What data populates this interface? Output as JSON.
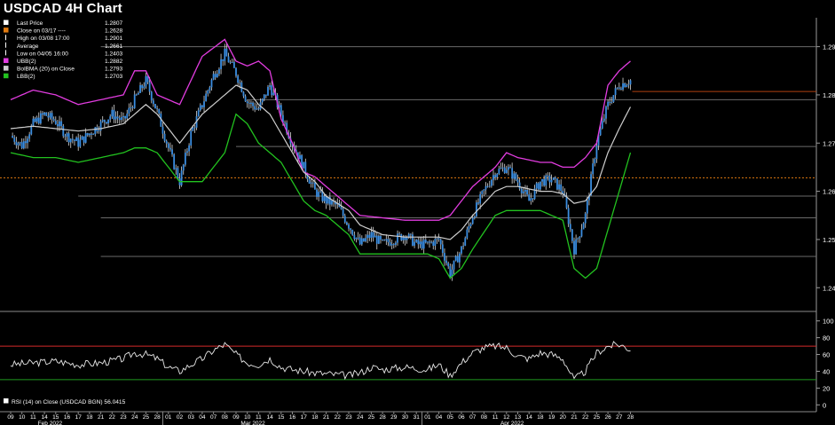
{
  "title": "USDCAD 4H Chart",
  "colors": {
    "background": "#000000",
    "candle": "#3a8de0",
    "upper_band": "#e23ce0",
    "lower_band": "#22c21f",
    "ma": "#cfcfcf",
    "close_line": "#e07a10",
    "last_price_line": "#b04010",
    "rsi_line": "#e8e8e8",
    "rsi_overbought": "#d42a2a",
    "rsi_oversold": "#1f9a1f",
    "grid": "#6a6a6a",
    "text": "#ffffff"
  },
  "legend": [
    {
      "label": "Last Price",
      "value": "1.2807",
      "swatch": "#ffffff",
      "style": "box"
    },
    {
      "label": "Close on 03/17 ----",
      "value": "1.2628",
      "swatch": "#e07a10",
      "style": "box"
    },
    {
      "label": "High on 03/08 17:00",
      "value": "1.2901",
      "swatch": "#ffffff",
      "style": "mark"
    },
    {
      "label": "Average",
      "value": "1.2661",
      "swatch": "#ffffff",
      "style": "mark"
    },
    {
      "label": "Low on 04/05 16:00",
      "value": "1.2403",
      "swatch": "#ffffff",
      "style": "mark"
    },
    {
      "label": "UBB(2)",
      "value": "1.2882",
      "swatch": "#e23ce0",
      "style": "box"
    },
    {
      "label": "BolBMA (20)  on Close",
      "value": "1.2793",
      "swatch": "#cfcfcf",
      "style": "box"
    },
    {
      "label": "LBB(2)",
      "value": "1.2703",
      "swatch": "#22c21f",
      "style": "box"
    }
  ],
  "rsi_legend": "RSI (14)  on Close (USDCAD BGN) 56.0415",
  "chart_data": {
    "type": "line",
    "price_axis": {
      "ticks": [
        "1.24",
        "1.25",
        "1.26",
        "1.27",
        "1.28",
        "1.29"
      ],
      "ylim": [
        1.236,
        1.296
      ]
    },
    "rsi_axis": {
      "ticks": [
        "0",
        "20",
        "40",
        "60",
        "80",
        "100"
      ],
      "ylim": [
        -6,
        106
      ]
    },
    "x_tick_labels": [
      "09",
      "10",
      "11",
      "14",
      "15",
      "16",
      "17",
      "18",
      "21",
      "22",
      "23",
      "24",
      "25",
      "28",
      "01",
      "02",
      "03",
      "04",
      "07",
      "08",
      "09",
      "10",
      "11",
      "14",
      "15",
      "16",
      "17",
      "18",
      "21",
      "22",
      "23",
      "24",
      "25",
      "28",
      "29",
      "30",
      "31",
      "01",
      "04",
      "05",
      "06",
      "07",
      "08",
      "11",
      "12",
      "13",
      "14",
      "18",
      "19",
      "20",
      "21",
      "22",
      "25",
      "26",
      "27",
      "28"
    ],
    "month_labels": [
      {
        "label": "Feb 2022",
        "at_tick": 3
      },
      {
        "label": "Mar 2022",
        "at_tick": 21
      },
      {
        "label": "Apr 2022",
        "at_tick": 44
      }
    ],
    "horizontal_levels": [
      {
        "value": 1.29,
        "x_start_tick": 8
      },
      {
        "value": 1.279,
        "x_start_tick": 21
      },
      {
        "value": 1.2693,
        "x_start_tick": 20
      },
      {
        "value": 1.259,
        "x_start_tick": 6
      },
      {
        "value": 1.2545,
        "x_start_tick": 8
      },
      {
        "value": 1.2465,
        "x_start_tick": 8
      }
    ],
    "close_on_0317": 1.2628,
    "last_price": 1.2807,
    "rsi_levels": {
      "overbought": 70,
      "oversold": 30
    },
    "rsi_last": 56.0415,
    "price_keypoints": [
      [
        0,
        1.2715
      ],
      [
        1,
        1.2695
      ],
      [
        2,
        1.274
      ],
      [
        3,
        1.276
      ],
      [
        4,
        1.2745
      ],
      [
        5,
        1.2715
      ],
      [
        6,
        1.27
      ],
      [
        7,
        1.272
      ],
      [
        8,
        1.274
      ],
      [
        9,
        1.276
      ],
      [
        10,
        1.2745
      ],
      [
        11,
        1.279
      ],
      [
        12,
        1.283
      ],
      [
        13,
        1.2765
      ],
      [
        14,
        1.269
      ],
      [
        15,
        1.262
      ],
      [
        16,
        1.272
      ],
      [
        17,
        1.278
      ],
      [
        18,
        1.284
      ],
      [
        19,
        1.2885
      ],
      [
        20,
        1.2845
      ],
      [
        21,
        1.2785
      ],
      [
        22,
        1.277
      ],
      [
        23,
        1.282
      ],
      [
        24,
        1.276
      ],
      [
        25,
        1.27
      ],
      [
        26,
        1.265
      ],
      [
        27,
        1.26
      ],
      [
        28,
        1.258
      ],
      [
        29,
        1.257
      ],
      [
        30,
        1.253
      ],
      [
        31,
        1.249
      ],
      [
        32,
        1.251
      ],
      [
        33,
        1.249
      ],
      [
        34,
        1.25
      ],
      [
        35,
        1.251
      ],
      [
        36,
        1.249
      ],
      [
        37,
        1.249
      ],
      [
        38,
        1.25
      ],
      [
        39,
        1.243
      ],
      [
        40,
        1.248
      ],
      [
        41,
        1.255
      ],
      [
        42,
        1.26
      ],
      [
        43,
        1.264
      ],
      [
        44,
        1.265
      ],
      [
        45,
        1.262
      ],
      [
        46,
        1.258
      ],
      [
        47,
        1.262
      ],
      [
        48,
        1.2625
      ],
      [
        49,
        1.26
      ],
      [
        50,
        1.248
      ],
      [
        51,
        1.255
      ],
      [
        52,
        1.27
      ],
      [
        53,
        1.278
      ],
      [
        54,
        1.282
      ],
      [
        55,
        1.283
      ],
      [
        56,
        1.2807
      ]
    ],
    "upper_band_keypoints": [
      [
        0,
        1.279
      ],
      [
        2,
        1.281
      ],
      [
        4,
        1.28
      ],
      [
        6,
        1.278
      ],
      [
        8,
        1.279
      ],
      [
        10,
        1.28
      ],
      [
        11,
        1.285
      ],
      [
        12,
        1.285
      ],
      [
        13,
        1.28
      ],
      [
        15,
        1.278
      ],
      [
        17,
        1.288
      ],
      [
        19,
        1.2915
      ],
      [
        20,
        1.287
      ],
      [
        21,
        1.286
      ],
      [
        22,
        1.287
      ],
      [
        23,
        1.285
      ],
      [
        24,
        1.275
      ],
      [
        25,
        1.27
      ],
      [
        26,
        1.264
      ],
      [
        27,
        1.263
      ],
      [
        28,
        1.261
      ],
      [
        30,
        1.257
      ],
      [
        31,
        1.255
      ],
      [
        33,
        1.2545
      ],
      [
        35,
        1.254
      ],
      [
        37,
        1.254
      ],
      [
        38,
        1.254
      ],
      [
        39,
        1.255
      ],
      [
        40,
        1.258
      ],
      [
        41,
        1.261
      ],
      [
        43,
        1.265
      ],
      [
        44,
        1.268
      ],
      [
        45,
        1.267
      ],
      [
        47,
        1.266
      ],
      [
        48,
        1.266
      ],
      [
        49,
        1.265
      ],
      [
        50,
        1.265
      ],
      [
        51,
        1.267
      ],
      [
        52,
        1.27
      ],
      [
        53,
        1.282
      ],
      [
        54,
        1.285
      ],
      [
        55,
        1.287
      ],
      [
        56,
        1.2885
      ]
    ],
    "ma_keypoints": [
      [
        0,
        1.273
      ],
      [
        2,
        1.2735
      ],
      [
        4,
        1.273
      ],
      [
        6,
        1.2725
      ],
      [
        8,
        1.273
      ],
      [
        10,
        1.274
      ],
      [
        11,
        1.276
      ],
      [
        12,
        1.278
      ],
      [
        13,
        1.276
      ],
      [
        15,
        1.27
      ],
      [
        17,
        1.276
      ],
      [
        19,
        1.28
      ],
      [
        20,
        1.282
      ],
      [
        21,
        1.281
      ],
      [
        22,
        1.278
      ],
      [
        23,
        1.276
      ],
      [
        24,
        1.272
      ],
      [
        25,
        1.268
      ],
      [
        26,
        1.264
      ],
      [
        27,
        1.262
      ],
      [
        28,
        1.259
      ],
      [
        30,
        1.256
      ],
      [
        31,
        1.253
      ],
      [
        33,
        1.251
      ],
      [
        35,
        1.2505
      ],
      [
        37,
        1.2505
      ],
      [
        38,
        1.2505
      ],
      [
        39,
        1.25
      ],
      [
        40,
        1.252
      ],
      [
        41,
        1.255
      ],
      [
        43,
        1.26
      ],
      [
        44,
        1.261
      ],
      [
        45,
        1.261
      ],
      [
        47,
        1.26
      ],
      [
        48,
        1.26
      ],
      [
        49,
        1.2595
      ],
      [
        50,
        1.2575
      ],
      [
        51,
        1.258
      ],
      [
        52,
        1.261
      ],
      [
        53,
        1.268
      ],
      [
        54,
        1.273
      ],
      [
        55,
        1.2775
      ],
      [
        56,
        1.2793
      ]
    ],
    "lower_band_keypoints": [
      [
        0,
        1.268
      ],
      [
        2,
        1.267
      ],
      [
        4,
        1.267
      ],
      [
        6,
        1.266
      ],
      [
        8,
        1.267
      ],
      [
        10,
        1.268
      ],
      [
        11,
        1.269
      ],
      [
        12,
        1.269
      ],
      [
        13,
        1.268
      ],
      [
        15,
        1.262
      ],
      [
        17,
        1.262
      ],
      [
        19,
        1.268
      ],
      [
        20,
        1.276
      ],
      [
        21,
        1.274
      ],
      [
        22,
        1.27
      ],
      [
        23,
        1.268
      ],
      [
        24,
        1.266
      ],
      [
        25,
        1.262
      ],
      [
        26,
        1.258
      ],
      [
        27,
        1.256
      ],
      [
        28,
        1.255
      ],
      [
        30,
        1.251
      ],
      [
        31,
        1.247
      ],
      [
        33,
        1.247
      ],
      [
        35,
        1.247
      ],
      [
        37,
        1.247
      ],
      [
        38,
        1.246
      ],
      [
        39,
        1.242
      ],
      [
        40,
        1.244
      ],
      [
        41,
        1.248
      ],
      [
        43,
        1.255
      ],
      [
        44,
        1.256
      ],
      [
        45,
        1.256
      ],
      [
        47,
        1.256
      ],
      [
        48,
        1.255
      ],
      [
        49,
        1.254
      ],
      [
        50,
        1.244
      ],
      [
        51,
        1.242
      ],
      [
        52,
        1.244
      ],
      [
        53,
        1.252
      ],
      [
        54,
        1.26
      ],
      [
        55,
        1.268
      ],
      [
        56,
        1.2703
      ]
    ],
    "rsi_keypoints": [
      [
        0,
        48
      ],
      [
        2,
        50
      ],
      [
        4,
        52
      ],
      [
        6,
        48
      ],
      [
        8,
        50
      ],
      [
        10,
        55
      ],
      [
        11,
        62
      ],
      [
        12,
        60
      ],
      [
        13,
        55
      ],
      [
        14,
        45
      ],
      [
        15,
        40
      ],
      [
        16,
        48
      ],
      [
        17,
        55
      ],
      [
        18,
        65
      ],
      [
        19,
        72
      ],
      [
        20,
        60
      ],
      [
        21,
        50
      ],
      [
        22,
        48
      ],
      [
        23,
        55
      ],
      [
        24,
        45
      ],
      [
        25,
        42
      ],
      [
        26,
        40
      ],
      [
        27,
        38
      ],
      [
        28,
        37
      ],
      [
        30,
        35
      ],
      [
        31,
        38
      ],
      [
        32,
        45
      ],
      [
        33,
        42
      ],
      [
        35,
        45
      ],
      [
        37,
        42
      ],
      [
        38,
        48
      ],
      [
        39,
        35
      ],
      [
        40,
        50
      ],
      [
        41,
        62
      ],
      [
        42,
        68
      ],
      [
        43,
        70
      ],
      [
        44,
        68
      ],
      [
        45,
        58
      ],
      [
        46,
        55
      ],
      [
        47,
        62
      ],
      [
        48,
        60
      ],
      [
        49,
        55
      ],
      [
        50,
        30
      ],
      [
        51,
        40
      ],
      [
        52,
        62
      ],
      [
        53,
        70
      ],
      [
        54,
        72
      ],
      [
        55,
        66
      ],
      [
        56,
        56
      ]
    ]
  }
}
